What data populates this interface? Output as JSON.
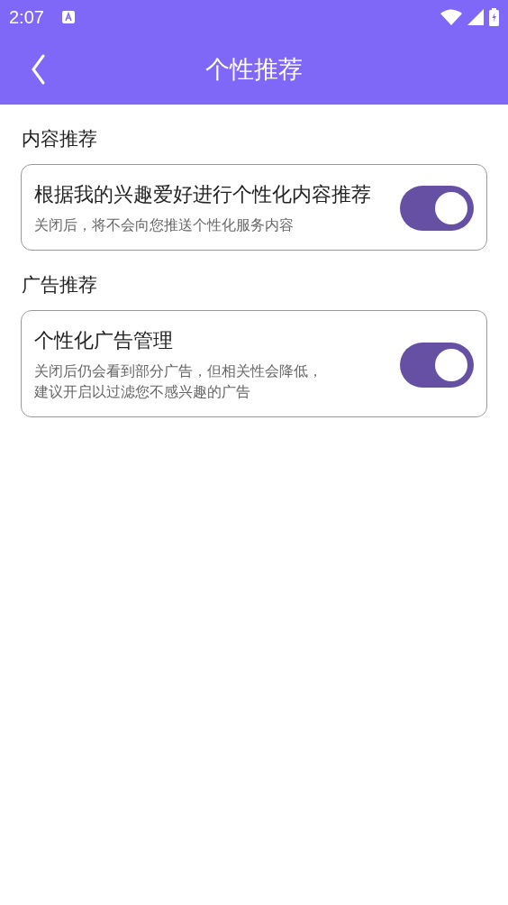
{
  "status_bar": {
    "time": "2:07"
  },
  "header": {
    "title": "个性推荐"
  },
  "sections": [
    {
      "heading": "内容推荐",
      "items": [
        {
          "title": "根据我的兴趣爱好进行个性化内容推荐",
          "description_lines": [
            "关闭后，将不会向您推送个性化服务内容"
          ],
          "on": true
        }
      ]
    },
    {
      "heading": "广告推荐",
      "items": [
        {
          "title": "个性化广告管理",
          "description_lines": [
            "关闭后仍会看到部分广告，但相关性会降低，",
            "建议开启以过滤您不感兴趣的广告"
          ],
          "on": true
        }
      ]
    }
  ]
}
